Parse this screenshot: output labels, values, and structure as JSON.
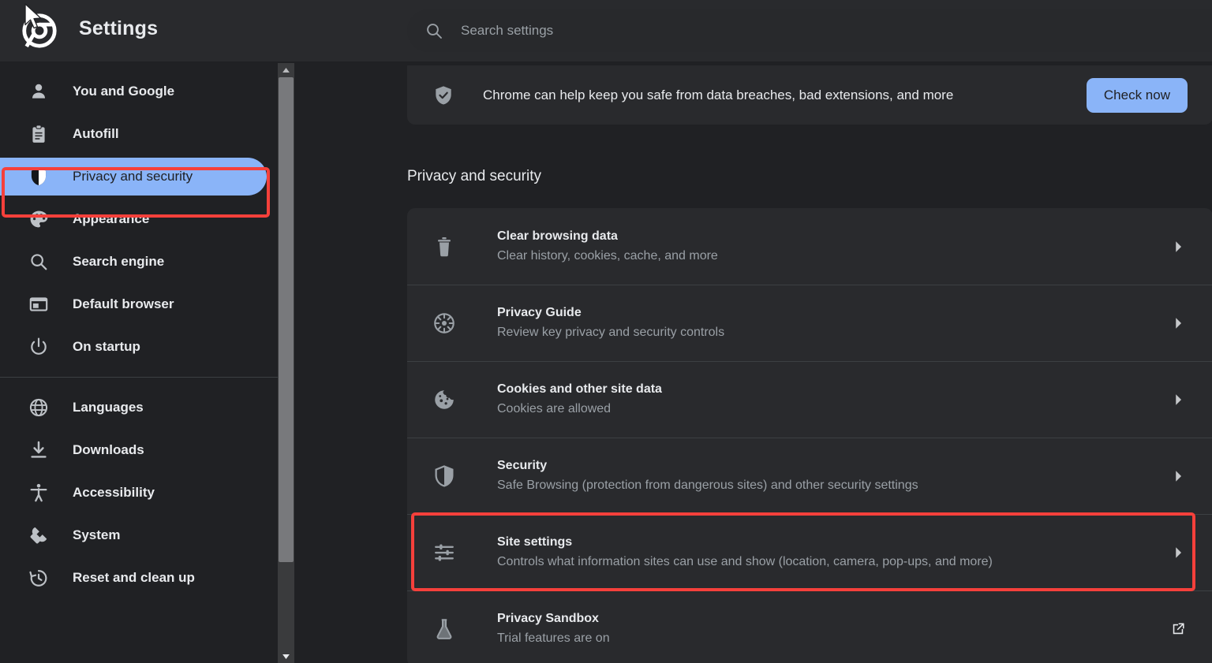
{
  "header": {
    "logo_icon": "chrome-logo-icon",
    "title": "Settings",
    "search": {
      "icon": "search-icon",
      "placeholder": "Search settings",
      "value": ""
    }
  },
  "sidebar": {
    "groups": [
      {
        "items": [
          {
            "icon": "person-icon",
            "label": "You and Google",
            "selected": false
          },
          {
            "icon": "clipboard-icon",
            "label": "Autofill",
            "selected": false
          },
          {
            "icon": "shield-icon",
            "label": "Privacy and security",
            "selected": true
          },
          {
            "icon": "palette-icon",
            "label": "Appearance",
            "selected": false
          },
          {
            "icon": "search-icon",
            "label": "Search engine",
            "selected": false
          },
          {
            "icon": "browser-window-icon",
            "label": "Default browser",
            "selected": false
          },
          {
            "icon": "power-icon",
            "label": "On startup",
            "selected": false
          }
        ]
      },
      {
        "items": [
          {
            "icon": "globe-icon",
            "label": "Languages",
            "selected": false
          },
          {
            "icon": "download-icon",
            "label": "Downloads",
            "selected": false
          },
          {
            "icon": "accessibility-icon",
            "label": "Accessibility",
            "selected": false
          },
          {
            "icon": "wrench-icon",
            "label": "System",
            "selected": false
          },
          {
            "icon": "history-icon",
            "label": "Reset and clean up",
            "selected": false
          }
        ]
      }
    ],
    "scrollbar": {
      "up_arrow_icon": "scroll-up-arrow-icon",
      "down_arrow_icon": "scroll-down-arrow-icon"
    }
  },
  "main": {
    "safety_check": {
      "icon": "shield-check-icon",
      "message": "Chrome can help keep you safe from data breaches, bad extensions, and more",
      "button_label": "Check now"
    },
    "section_heading": "Privacy and security",
    "rows": [
      {
        "icon": "trash-icon",
        "title": "Clear browsing data",
        "subtitle": "Clear history, cookies, cache, and more",
        "arrow": "chevron-right-icon"
      },
      {
        "icon": "privacy-guide-icon",
        "title": "Privacy Guide",
        "subtitle": "Review key privacy and security controls",
        "arrow": "chevron-right-icon"
      },
      {
        "icon": "cookie-icon",
        "title": "Cookies and other site data",
        "subtitle": "Cookies are allowed",
        "arrow": "chevron-right-icon"
      },
      {
        "icon": "shield-icon",
        "title": "Security",
        "subtitle": "Safe Browsing (protection from dangerous sites) and other security settings",
        "arrow": "chevron-right-icon"
      },
      {
        "icon": "tune-sliders-icon",
        "title": "Site settings",
        "subtitle": "Controls what information sites can use and show (location, camera, pop-ups, and more)",
        "arrow": "chevron-right-icon"
      },
      {
        "icon": "flask-icon",
        "title": "Privacy Sandbox",
        "subtitle": "Trial features are on",
        "arrow": "open-in-new-icon"
      }
    ]
  },
  "annotations": {
    "color": "#F5403B",
    "targets": [
      "sidebar-item-privacy-and-security",
      "setting-row-site-settings"
    ]
  },
  "colors": {
    "page_background": "#202124",
    "card_background": "#292A2D",
    "accent_blue": "#8AB4F8",
    "text_primary": "#E8EAED",
    "text_secondary": "#9AA0A6",
    "divider": "#3C4043",
    "annotation_red": "#F5403B"
  }
}
